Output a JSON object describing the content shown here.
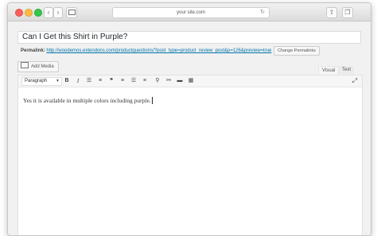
{
  "browser": {
    "url": "your site.com"
  },
  "post": {
    "title": "Can I Get this Shirt in Purple?",
    "permalink_label": "Permalink:",
    "permalink_url": "http://woodemos.extendons.com/productquestions/?post_type=product_review_post&p=126&preview=true",
    "change_permalinks_label": "Change Permalinks",
    "add_media_label": "Add Media",
    "body": "Yes it is available in multiple colors including purple."
  },
  "editor": {
    "tabs": [
      "Visual",
      "Text"
    ],
    "format_select": "Paragraph"
  }
}
